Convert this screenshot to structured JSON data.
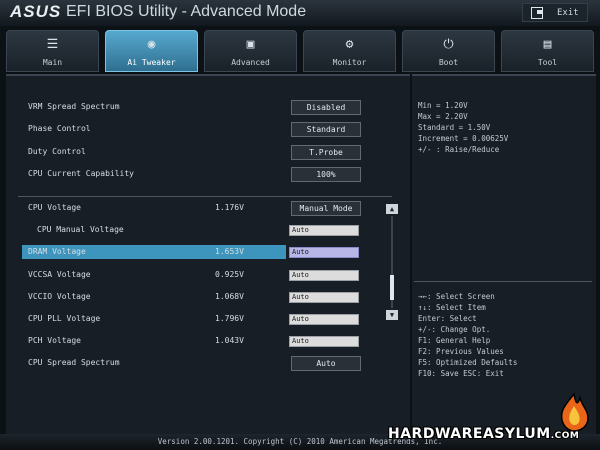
{
  "header": {
    "brand": "ASUS",
    "title": "EFI BIOS Utility - Advanced Mode",
    "exit_label": "Exit"
  },
  "tabs": [
    {
      "label": "Main",
      "icon": "list-icon"
    },
    {
      "label": "Ai Tweaker",
      "icon": "tweaker-icon"
    },
    {
      "label": "Advanced",
      "icon": "advanced-icon"
    },
    {
      "label": "Monitor",
      "icon": "monitor-icon"
    },
    {
      "label": "Boot",
      "icon": "power-icon"
    },
    {
      "label": "Tool",
      "icon": "toolbox-icon"
    }
  ],
  "active_tab": "Ai Tweaker",
  "settings_top": [
    {
      "label": "VRM Spread Spectrum",
      "button": "Disabled"
    },
    {
      "label": "Phase Control",
      "button": "Standard"
    },
    {
      "label": "Duty Control",
      "button": "T.Probe"
    },
    {
      "label": "CPU Current Capability",
      "button": "100%"
    }
  ],
  "settings_voltage": [
    {
      "label": "CPU Voltage",
      "value": "1.176V",
      "button": "Manual Mode"
    },
    {
      "label": "CPU Manual Voltage",
      "input": "Auto"
    },
    {
      "label": "DRAM Voltage",
      "value": "1.653V",
      "input": "Auto"
    },
    {
      "label": "VCCSA Voltage",
      "value": "0.925V",
      "input": "Auto"
    },
    {
      "label": "VCCIO Voltage",
      "value": "1.068V",
      "input": "Auto"
    },
    {
      "label": "CPU PLL Voltage",
      "value": "1.796V",
      "input": "Auto"
    },
    {
      "label": "PCH Voltage",
      "value": "1.043V",
      "input": "Auto"
    },
    {
      "label": "CPU Spread Spectrum",
      "button": "Auto"
    }
  ],
  "info_lines": [
    "Min = 1.20V",
    "Max = 2.20V",
    "Standard = 1.50V",
    "Increment = 0.00625V",
    "+/- : Raise/Reduce"
  ],
  "key_help": [
    "→←: Select Screen",
    "↑↓: Select Item",
    "Enter: Select",
    "+/-: Change Opt.",
    "F1: General Help",
    "F2: Previous Values",
    "F5: Optimized Defaults",
    "F10: Save  ESC: Exit"
  ],
  "footer": "Version 2.00.1201. Copyright (C) 2010 American Megatrends, Inc.",
  "watermark": {
    "name": "HARDWAREASYLUM",
    "suffix": ".COM"
  }
}
